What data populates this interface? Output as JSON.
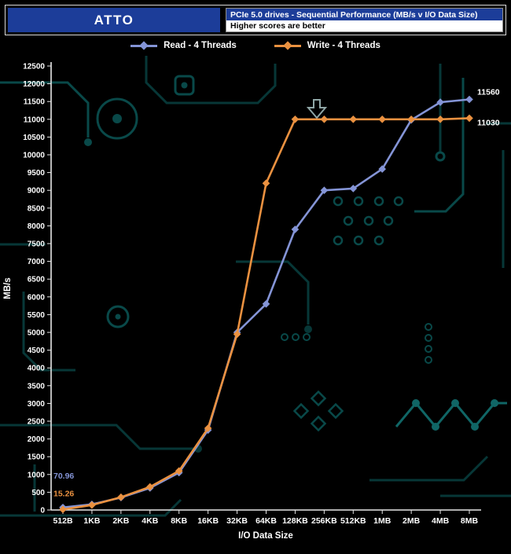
{
  "header": {
    "app": "ATTO",
    "title": "PCIe 5.0 drives - Sequential Performance (MB/s v I/O Data Size)",
    "subtitle": "Higher scores are better"
  },
  "colors": {
    "header_blue": "#1c3d99",
    "background": "#000000",
    "axis": "#e8e8e8",
    "pcb_teal": "#0b5151",
    "read": "#8494d6",
    "write": "#ea9140"
  },
  "chart_data": {
    "type": "line",
    "title": "PCIe 5.0 drives - Sequential Performance (MB/s v I/O Data Size)",
    "subtitle": "Higher scores are better",
    "xlabel": "I/O Data Size",
    "ylabel": "MB/s",
    "ylim": [
      0,
      12500
    ],
    "ytick_step": 500,
    "grid": false,
    "legend_position": "top",
    "categories": [
      "512B",
      "1KB",
      "2KB",
      "4KB",
      "8KB",
      "16KB",
      "32KB",
      "64KB",
      "128KB",
      "256KB",
      "512KB",
      "1MB",
      "2MB",
      "4MB",
      "8MB"
    ],
    "series": [
      {
        "name": "Read - 4 Threads",
        "color": "#8494d6",
        "values": [
          70.96,
          160,
          350,
          620,
          1050,
          2250,
          5000,
          5800,
          7900,
          9000,
          9050,
          9600,
          10980,
          11480,
          11560
        ]
      },
      {
        "name": "Write - 4 Threads",
        "color": "#ea9140",
        "values": [
          15.26,
          140,
          360,
          650,
          1100,
          2300,
          4950,
          9200,
          11000,
          11000,
          11000,
          11000,
          11000,
          11000,
          11030
        ]
      }
    ],
    "annotations": [
      {
        "text": "70.96",
        "series_index": 0,
        "point_index": 0,
        "dx": -12,
        "dy": -37,
        "anchor": "start",
        "color": "#8494d6"
      },
      {
        "text": "15.26",
        "series_index": 1,
        "point_index": 0,
        "dx": -12,
        "dy": -17,
        "anchor": "start",
        "color": "#ea9140"
      },
      {
        "text": "11560",
        "series_index": 0,
        "point_index": 14,
        "dx": 10,
        "dy": -6,
        "anchor": "start",
        "color": "#ffffff"
      },
      {
        "text": "11030",
        "series_index": 1,
        "point_index": 14,
        "dx": 10,
        "dy": 9,
        "anchor": "start",
        "color": "#ffffff"
      }
    ]
  }
}
